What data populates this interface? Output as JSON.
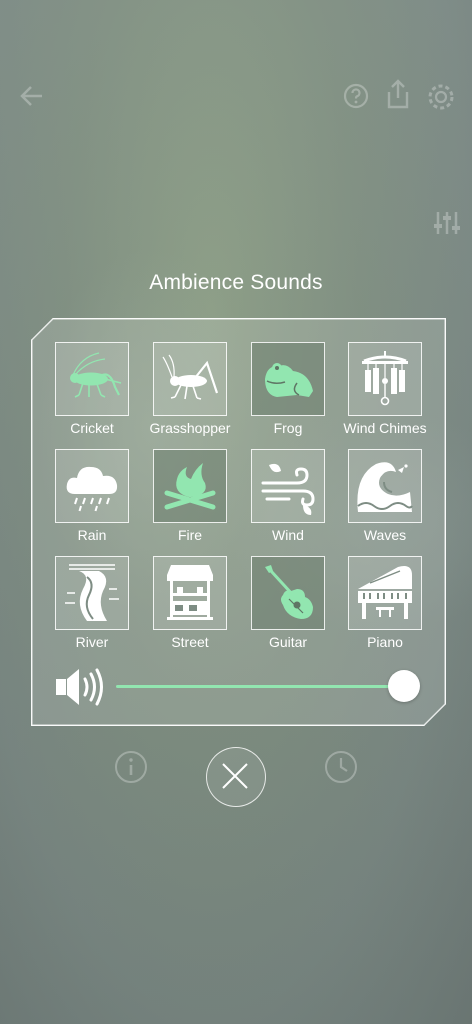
{
  "title": "Ambience Sounds",
  "accent": "#92e6b0",
  "sounds": [
    {
      "label": "Cricket",
      "icon": "cricket-icon",
      "active": true
    },
    {
      "label": "Grasshopper",
      "icon": "grasshopper-icon",
      "active": false
    },
    {
      "label": "Frog",
      "icon": "frog-icon",
      "active": true
    },
    {
      "label": "Wind Chimes",
      "icon": "wind-chimes-icon",
      "active": false
    },
    {
      "label": "Rain",
      "icon": "rain-cloud-icon",
      "active": false
    },
    {
      "label": "Fire",
      "icon": "campfire-icon",
      "active": true
    },
    {
      "label": "Wind",
      "icon": "wind-icon",
      "active": false
    },
    {
      "label": "Waves",
      "icon": "waves-icon",
      "active": false
    },
    {
      "label": "River",
      "icon": "river-icon",
      "active": false
    },
    {
      "label": "Street",
      "icon": "street-stall-icon",
      "active": false
    },
    {
      "label": "Guitar",
      "icon": "guitar-icon",
      "active": true
    },
    {
      "label": "Piano",
      "icon": "piano-icon",
      "active": false
    }
  ],
  "volume": {
    "icon": "speaker-icon",
    "level": 1.0
  },
  "close": {
    "icon": "close-icon"
  },
  "background_icons": [
    "back-arrow-icon",
    "help-icon",
    "share-icon",
    "settings-icon",
    "equalizer-icon",
    "info-icon",
    "timer-icon"
  ]
}
